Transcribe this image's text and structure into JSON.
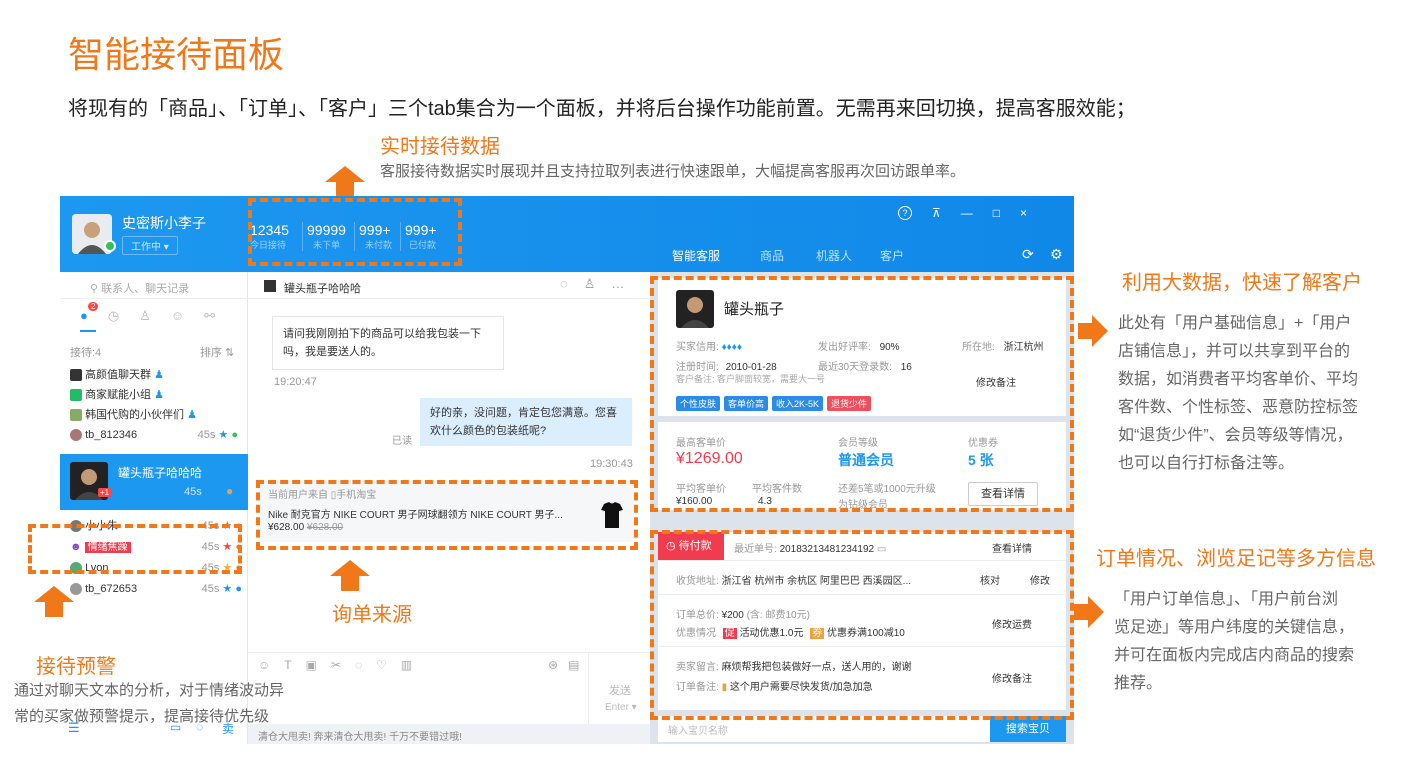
{
  "page": {
    "title": "智能接待面板",
    "subtitle": "将现有的「商品」、「订单」、「客户」三个tab集合为一个面板，并将后台操作功能前置。无需再来回切换，提高客服效能；"
  },
  "annotations": {
    "realtime_title": "实时接待数据",
    "realtime_text": "客服接待数据实时展现并且支持拉取列表进行快速跟单，大幅提高客服再次回访跟单率。",
    "bigdata_title": "利用大数据，快速了解客户",
    "bigdata_lines": [
      "此处有「用户基础信息」+「用户",
      "店铺信息」，并可以共享到平台的",
      "数据，如消费者平均客单价、平均",
      "客件数、个性标签、恶意防控标签",
      "如“退货少件”、会员等级等情况，",
      "也可以自行打标备注等。"
    ],
    "order_title": "订单情况、浏览足记等多方信息",
    "order_lines": [
      "「用户订单信息」、「用户前台浏",
      "览足迹」等用户纬度的关键信息，",
      "并可在面板内完成店内商品的搜索",
      "推荐。"
    ],
    "inquiry_title": "询单来源",
    "warning_title": "接待预警",
    "warning_lines": [
      "通过对聊天文本的分析，对于情绪波动异",
      "常的买家做预警提示，提高接待优先级"
    ]
  },
  "app": {
    "user_name": "史密斯小李子",
    "user_status": "工作中 ▾",
    "stats": [
      {
        "value": "12345",
        "label": "今日接待"
      },
      {
        "value": "99999",
        "label": "未下单"
      },
      {
        "value": "999+",
        "label": "未付款"
      },
      {
        "value": "999+",
        "label": "已付款"
      }
    ],
    "panel_tabs": [
      "智能客服",
      "商品",
      "机器人",
      "客户"
    ],
    "window_controls": {
      "help": "?",
      "pin": "⊼",
      "min": "—",
      "max": "□",
      "close": "×"
    },
    "sidebar": {
      "search_placeholder": "联系人、聊天记录",
      "badge": "2",
      "reception_label": "接待:4",
      "sort_label": "排序 ⇅",
      "groups": [
        "高颜值聊天群",
        "商家赋能小组",
        "韩国代购的小伙伴们"
      ],
      "contacts_top": [
        {
          "name": "tb_812346",
          "time": "45s"
        }
      ],
      "active": {
        "name": "罐头瓶子哈哈哈",
        "time": "45s",
        "badge": "+1"
      },
      "contacts_bottom": [
        {
          "name": "小小朱",
          "time": "45s"
        },
        {
          "name": "情绪焦躁",
          "time": "45s"
        },
        {
          "name": "Lyon",
          "time": "45s"
        },
        {
          "name": "tb_672653",
          "time": "45s"
        }
      ],
      "bottom_icons": {
        "menu": "☰",
        "note": "▭",
        "chat": "◌",
        "sell": "卖"
      }
    },
    "chat": {
      "contact": "罐头瓶子哈哈哈",
      "msg_in": [
        "请问我刚刚拍下的商品可以给我包装一下",
        "吗，我是要送人的。"
      ],
      "time_in": "19:20:47",
      "msg_out": [
        "好的亲，没问题，肯定包您满意。您喜",
        "欢什么颜色的包装纸呢?"
      ],
      "read_label": "已读",
      "time_out": "19:30:43",
      "source_label": "当前用户来自",
      "source_device": "手机淘宝",
      "product_name": "Nike 耐克官方 NIKE COURT 男子网球翻领方 NIKE COURT 男子...",
      "product_price": "¥628.00",
      "product_old_price": "¥628.00",
      "send_label": "发送",
      "enter_label": "Enter ▾",
      "footer_text": "清仓大甩卖! 奔来清仓大甩卖! 千万不要错过哦!"
    },
    "customer": {
      "name": "罐头瓶子",
      "credit_label": "买家信用:",
      "good_rate_label": "发出好评率:",
      "good_rate": "90%",
      "location_label": "所在地:",
      "location": "浙江杭州",
      "reg_label": "注册时间:",
      "reg_date": "2010-01-28",
      "login_label": "最近30天登录数:",
      "login_count": "16",
      "remark_label": "客户备注:",
      "remark": "客户脚面较宽，需要大一号",
      "edit_remark": "修改备注",
      "tags": [
        {
          "text": "个性皮肤",
          "color": "#2a8ce8"
        },
        {
          "text": "客单价高",
          "color": "#2a8ce8"
        },
        {
          "text": "收入2K-5K",
          "color": "#2a8ce8"
        },
        {
          "text": "退货少件",
          "color": "#f04e5e"
        }
      ]
    },
    "stats_card": {
      "max_price_label": "最高客单价",
      "max_price": "¥1269.00",
      "level_label": "会员等级",
      "level": "普通会员",
      "coupon_label": "优惠券",
      "coupon": "5 张",
      "avg_price_label": "平均客单价",
      "avg_price": "¥160.00",
      "avg_count_label": "平均客件数",
      "avg_count": "4.3",
      "upgrade_text": "还差5笔或1000元升级",
      "upgrade_text2": "为钻级会员",
      "detail_button": "查看详情"
    },
    "order": {
      "status": "待付款",
      "order_no_label": "最近单号:",
      "order_no": "20183213481234192",
      "detail_link": "查看详情",
      "addr_label": "收货地址:",
      "addr": "浙江省 杭州市 余杭区 阿里巴巴 西溪园区...",
      "verify": "核对",
      "modify": "修改",
      "total_label": "订单总价:",
      "total": "¥200",
      "shipping": "(含: 邮费10元)",
      "discount_label": "优惠情况",
      "promo1_tag": "促",
      "promo1": "活动优惠1.0元",
      "promo2_tag": "券",
      "promo2": "优惠券满100减10",
      "modify_shipping": "修改运费",
      "seller_msg_label": "卖家留言:",
      "seller_msg": "麻烦帮我把包装做好一点，送人用的，谢谢",
      "order_remark_label": "订单备注:",
      "order_remark": "这个用户需要尽快发货/加急加急",
      "modify_remark": "修改备注",
      "search_placeholder": "输入宝贝名称",
      "search_button": "搜索宝贝"
    }
  }
}
